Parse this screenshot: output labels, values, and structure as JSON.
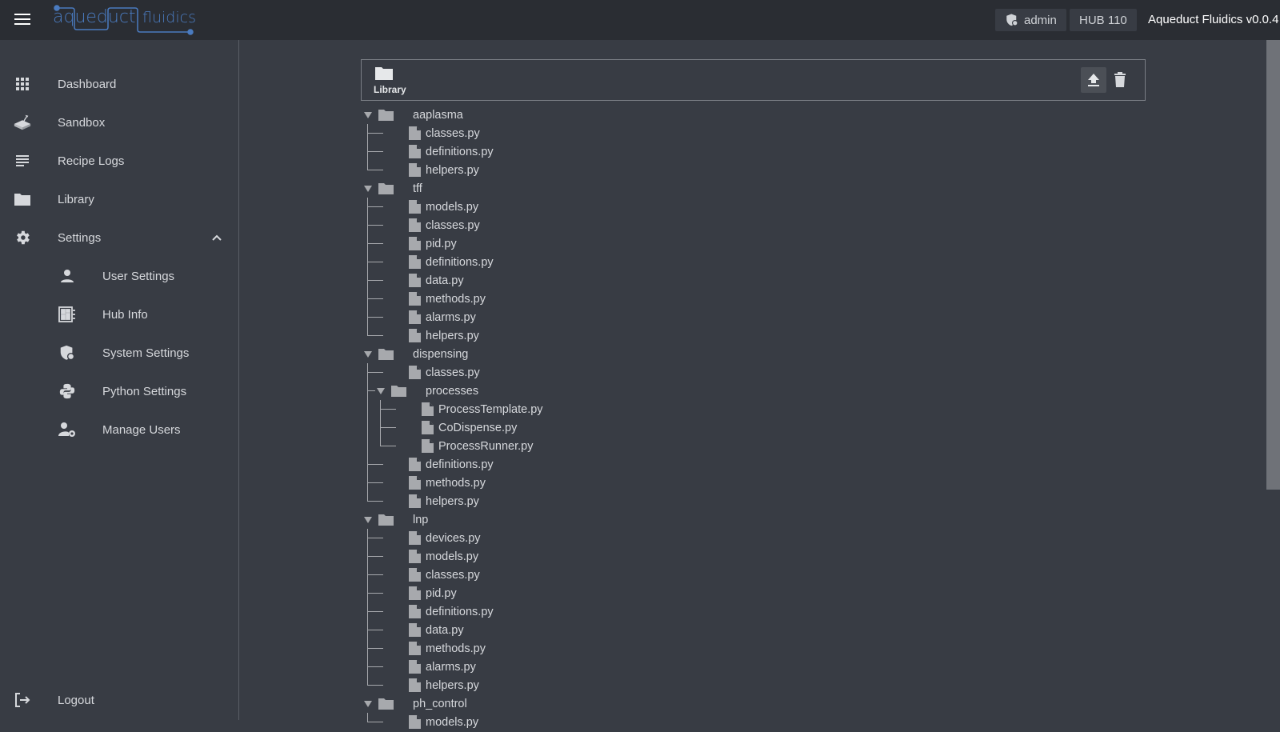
{
  "topbar": {
    "app_name": "aqueduct fluidics",
    "user_badge": "admin",
    "hub_badge": "HUB 110",
    "version": "Aqueduct Fluidics v0.0.4",
    "colors": {
      "logo": "#4a7bc0",
      "bar": "#2a2d33"
    }
  },
  "sidebar": {
    "items": [
      {
        "label": "Dashboard",
        "icon": "grid-icon"
      },
      {
        "label": "Sandbox",
        "icon": "sandbox-icon"
      },
      {
        "label": "Recipe Logs",
        "icon": "list-icon"
      },
      {
        "label": "Library",
        "icon": "folder-icon"
      },
      {
        "label": "Settings",
        "icon": "gear-icon",
        "expanded": true
      }
    ],
    "settings_items": [
      {
        "label": "User Settings",
        "icon": "person-icon"
      },
      {
        "label": "Hub Info",
        "icon": "hub-info-icon"
      },
      {
        "label": "System Settings",
        "icon": "shield-icon"
      },
      {
        "label": "Python Settings",
        "icon": "python-icon"
      },
      {
        "label": "Manage Users",
        "icon": "manage-users-icon"
      }
    ],
    "logout": "Logout"
  },
  "library": {
    "title": "Library",
    "upload_label": "upload",
    "delete_label": "delete",
    "tree": [
      {
        "name": "aaplasma",
        "type": "folder",
        "children": [
          "classes.py",
          "definitions.py",
          "helpers.py"
        ]
      },
      {
        "name": "tff",
        "type": "folder",
        "children": [
          "models.py",
          "classes.py",
          "pid.py",
          "definitions.py",
          "data.py",
          "methods.py",
          "alarms.py",
          "helpers.py"
        ]
      },
      {
        "name": "dispensing",
        "type": "folder",
        "children": [
          "classes.py",
          {
            "name": "processes",
            "type": "folder",
            "children": [
              "ProcessTemplate.py",
              "CoDispense.py",
              "ProcessRunner.py"
            ]
          },
          "definitions.py",
          "methods.py",
          "helpers.py"
        ]
      },
      {
        "name": "lnp",
        "type": "folder",
        "children": [
          "devices.py",
          "models.py",
          "classes.py",
          "pid.py",
          "definitions.py",
          "data.py",
          "methods.py",
          "alarms.py",
          "helpers.py"
        ]
      },
      {
        "name": "ph_control",
        "type": "folder",
        "children": [
          "models.py"
        ]
      }
    ]
  }
}
